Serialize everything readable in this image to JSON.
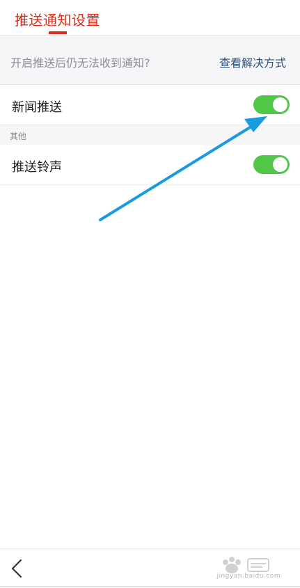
{
  "header": {
    "title": "推送通知设置"
  },
  "help_bar": {
    "text": "开启推送后仍无法收到通知?",
    "link": "查看解决方式"
  },
  "settings": [
    {
      "label": "新闻推送",
      "enabled": true
    },
    {
      "label": "推送铃声",
      "enabled": true
    }
  ],
  "section": {
    "label": "其他"
  },
  "colors": {
    "accent": "#d7301f",
    "toggle_on": "#52c646",
    "link": "#2a4f7a",
    "annotation_arrow": "#1a9be0"
  },
  "icons": {
    "back": "chevron-left-icon"
  },
  "watermark": {
    "text": "jingyan.baidu.com"
  }
}
